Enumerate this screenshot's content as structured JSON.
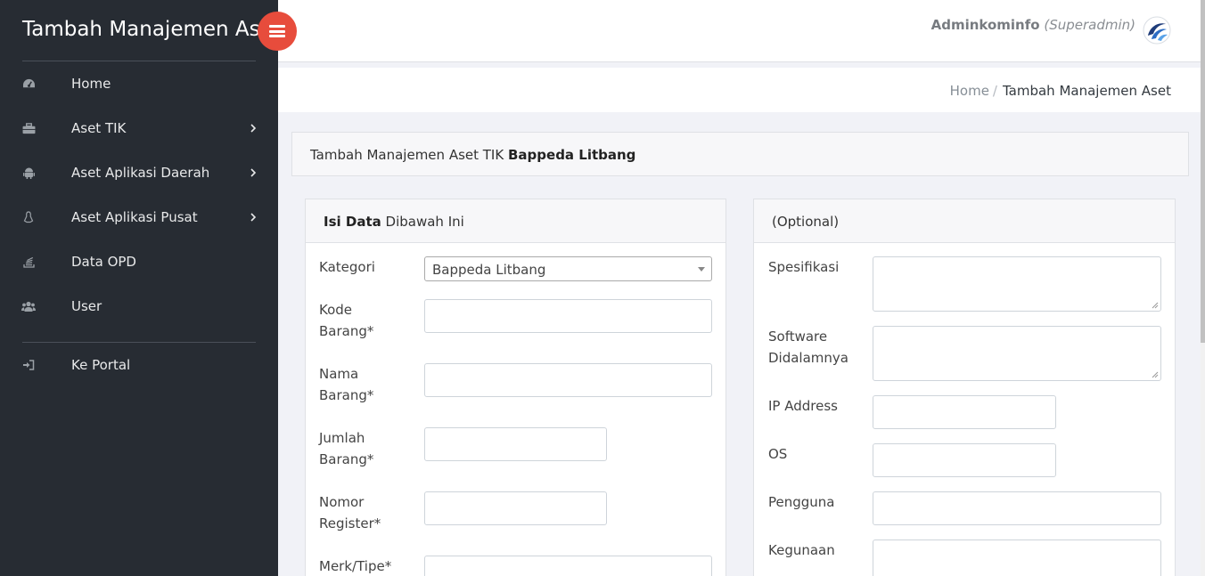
{
  "app": {
    "title": "Tambah Manajemen Aset"
  },
  "sidebar": {
    "items": [
      {
        "label": "Home",
        "icon": "dashboard-icon"
      },
      {
        "label": "Aset TIK",
        "icon": "briefcase-icon",
        "has_submenu": true
      },
      {
        "label": "Aset Aplikasi Daerah",
        "icon": "android-icon",
        "has_submenu": true
      },
      {
        "label": "Aset Aplikasi Pusat",
        "icon": "linux-icon",
        "has_submenu": true
      },
      {
        "label": "Data OPD",
        "icon": "stack-icon"
      },
      {
        "label": "User",
        "icon": "users-icon"
      }
    ],
    "portal": {
      "label": "Ke Portal",
      "icon": "sign-in-icon"
    }
  },
  "header": {
    "user_name": "Adminkominfo",
    "user_role": "(Superadmin)"
  },
  "breadcrumb": {
    "home": "Home",
    "separator": "/",
    "current": "Tambah Manajemen Aset"
  },
  "main": {
    "title_prefix": "Tambah Manajemen Aset TIK",
    "title_org": "Bappeda Litbang"
  },
  "left_panel": {
    "heading_bold": "Isi Data",
    "heading_rest": "Dibawah Ini",
    "kategori_label": "Kategori",
    "kategori_value": "Bappeda Litbang",
    "kode_label_1": "Kode",
    "kode_label_2": "Barang*",
    "nama_label_1": "Nama",
    "nama_label_2": "Barang*",
    "jumlah_label_1": "Jumlah",
    "jumlah_label_2": "Barang*",
    "nomor_label_1": "Nomor",
    "nomor_label_2": "Register*",
    "merk_label": "Merk/Tipe*"
  },
  "right_panel": {
    "heading": "(Optional)",
    "spesifikasi_label": "Spesifikasi",
    "software_label_1": "Software",
    "software_label_2": "Didalamnya",
    "ip_label": "IP Address",
    "os_label": "OS",
    "pengguna_label": "Pengguna",
    "kegunaan_label": "Kegunaan"
  },
  "colors": {
    "sidebar_bg": "#272c33",
    "toggle_accent": "#e74c3c",
    "page_bg": "#f1f2f7"
  }
}
